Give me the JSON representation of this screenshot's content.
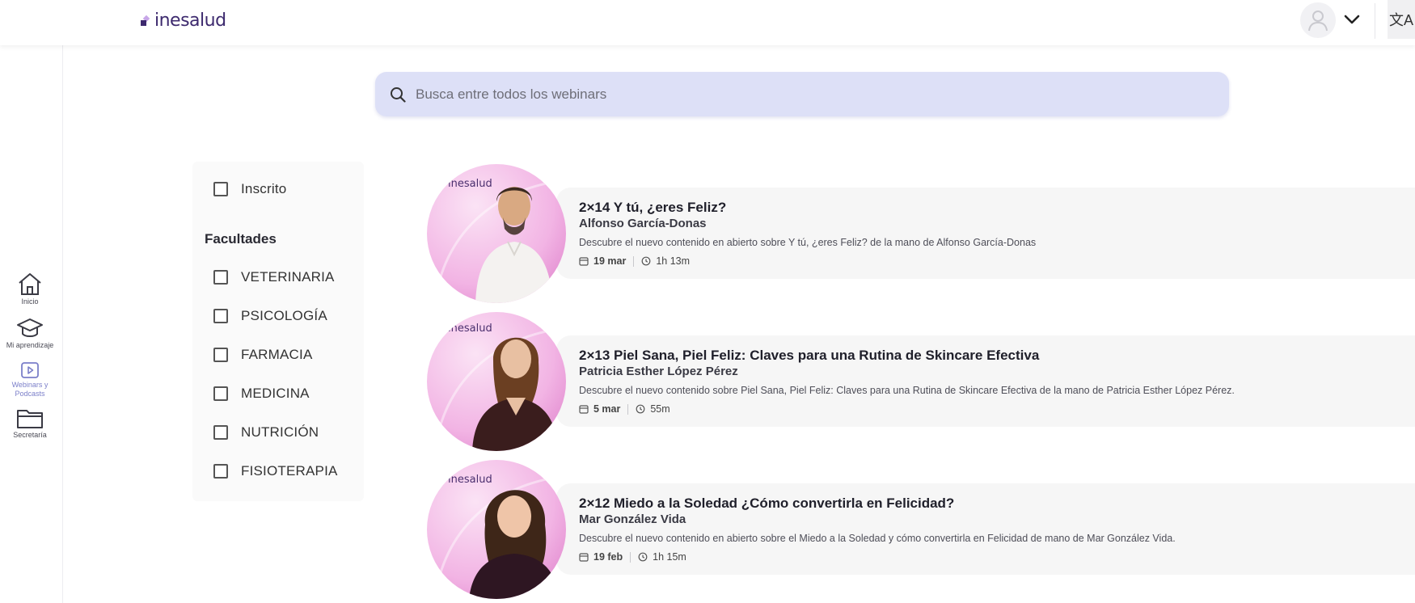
{
  "header": {
    "logo_text": "inesalud",
    "avatar_icon": "user-icon",
    "menu_icon": "chevron-down-icon",
    "translate_icon": "translate-icon",
    "translate_glyph": "文A"
  },
  "sidebar": {
    "items": [
      {
        "label": "Inicio",
        "icon": "home-icon",
        "active": false
      },
      {
        "label": "Mi aprendizaje",
        "icon": "graduation-cap-icon",
        "active": false
      },
      {
        "label": "Webinars y Podcasts",
        "icon": "play-icon",
        "active": true
      },
      {
        "label": "Secretaría",
        "icon": "folder-icon",
        "active": false
      }
    ]
  },
  "search": {
    "placeholder": "Busca entre todos los webinars",
    "value": ""
  },
  "filters": {
    "enrolled_label": "Inscrito",
    "faculties_title": "Facultades",
    "faculties": [
      {
        "label": "VETERINARIA",
        "checked": false
      },
      {
        "label": "PSICOLOGÍA",
        "checked": false
      },
      {
        "label": "FARMACIA",
        "checked": false
      },
      {
        "label": "MEDICINA",
        "checked": false
      },
      {
        "label": "NUTRICIÓN",
        "checked": false
      },
      {
        "label": "FISIOTERAPIA",
        "checked": false
      }
    ]
  },
  "webinars": [
    {
      "thumb_text": "inesalud",
      "title": "2×14 Y tú, ¿eres Feliz?",
      "author": "Alfonso García-Donas",
      "description": "Descubre el nuevo contenido en abierto sobre Y tú, ¿eres Feliz? de la mano de Alfonso García-Donas",
      "date": "19 mar",
      "duration": "1h 13m"
    },
    {
      "thumb_text": "inesalud",
      "title": "2×13 Piel Sana, Piel Feliz: Claves para una Rutina de Skincare Efectiva",
      "author": "Patricia Esther López Pérez",
      "description": "Descubre el nuevo contenido sobre Piel Sana, Piel Feliz: Claves para una Rutina de Skincare Efectiva de la mano de Patricia Esther López Pérez.",
      "date": "5 mar",
      "duration": "55m"
    },
    {
      "thumb_text": "inesalud",
      "title": "2×12 Miedo a la Soledad ¿Cómo convertirla en Felicidad?",
      "author": "Mar González Vida",
      "description": "Descubre el nuevo contenido en abierto sobre el Miedo a la Soledad y cómo convertirla en Felicidad de mano de Mar González Vida.",
      "date": "19 feb",
      "duration": "1h 15m"
    }
  ],
  "colors": {
    "brand": "#3d2a6e",
    "search_bg": "#dde0f7",
    "active_nav": "#7b7fc9",
    "card_bg": "#f6f6f6",
    "thumb_pink": "#f3b6e6"
  }
}
